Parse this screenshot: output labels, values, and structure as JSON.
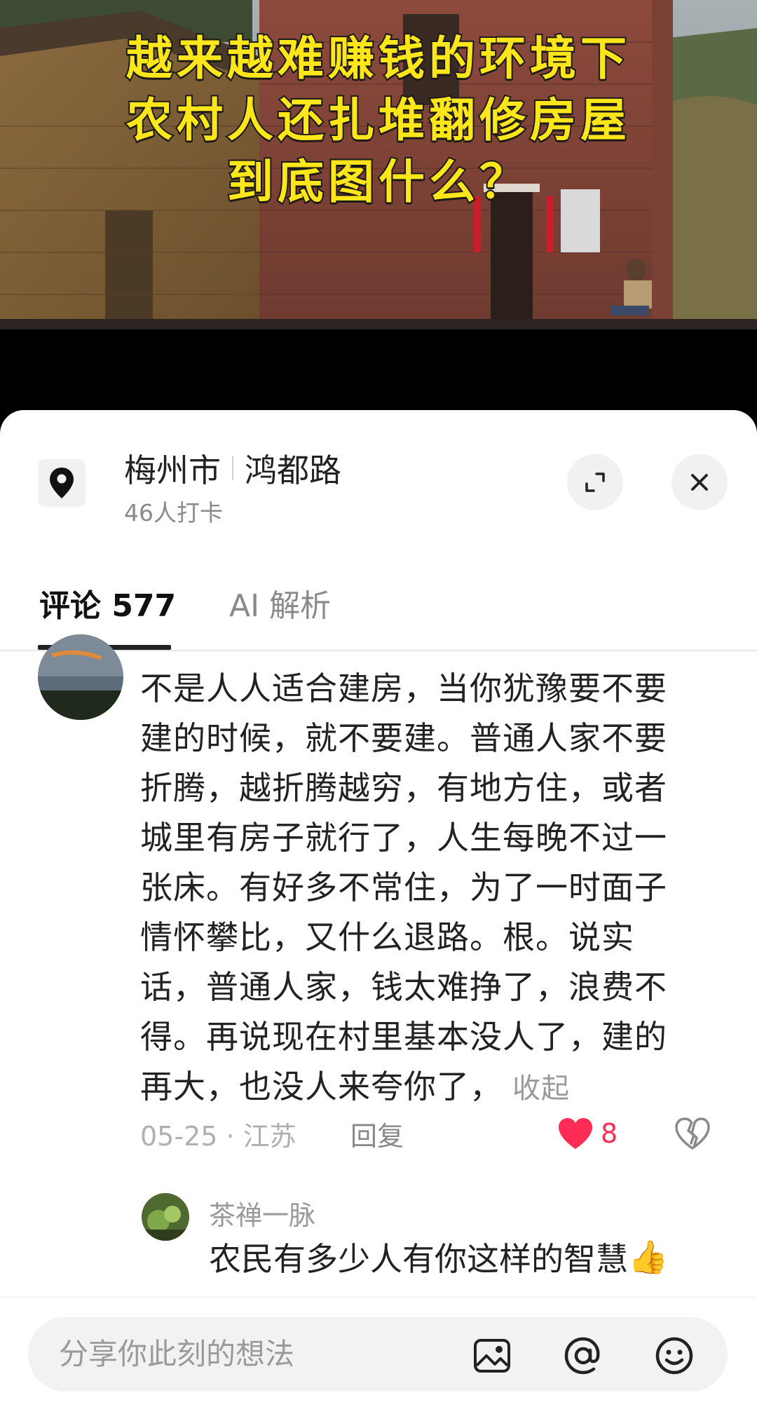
{
  "video": {
    "caption_lines": [
      "越来越难赚钱的环境下",
      "农村人还扎堆翻修房屋",
      "到底图什么？"
    ]
  },
  "location": {
    "city": "梅州市",
    "road": "鸿都路",
    "checkins": "46人打卡"
  },
  "tabs": {
    "comments": "评论 577",
    "ai": "AI 解析"
  },
  "comment": {
    "lines": [
      "不是人人适合建房，当你犹豫要不要",
      "建的时候，就不要建。普通人家不要",
      "折腾，越折腾越穷，有地方住，或者",
      "城里有房子就行了，人生每晚不过一",
      "张床。有好多不常住，为了一时面子",
      "情怀攀比，又什么退路。根。说实",
      "话，普通人家，钱太难挣了，浪费不",
      "得。再说现在村里基本没人了，建的",
      "再大，也没人来夸你了，"
    ],
    "collapse": "收起",
    "meta": "05-25 · 江苏",
    "reply": "回复",
    "likes": "8"
  },
  "reply_comment": {
    "user": "茶禅一脉",
    "text": "农民有多少人有你这样的智慧",
    "emoji": "👍"
  },
  "input": {
    "placeholder": "分享你此刻的想法"
  },
  "icons": {
    "location": "location-pin-icon",
    "expand": "expand-icon",
    "close": "close-icon",
    "like": "heart-icon",
    "dislike": "broken-heart-icon",
    "image": "image-icon",
    "mention": "at-icon",
    "emoji": "emoji-icon"
  },
  "colors": {
    "caption": "#ffe61a",
    "like": "#ff2c55",
    "text": "#222222",
    "muted": "#9a9a9a"
  }
}
